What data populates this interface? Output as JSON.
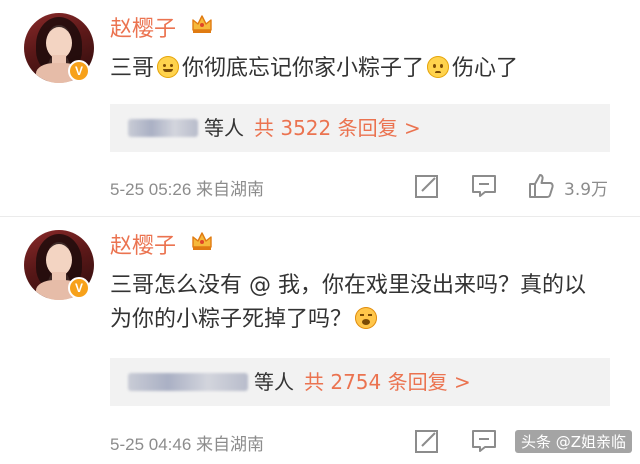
{
  "comments": [
    {
      "username": "赵樱子",
      "text_parts": [
        "三哥",
        "你彻底忘记你家小粽子了",
        "伤心了"
      ],
      "replies_suffix": "等人",
      "replies_link": "共 3522 条回复 >",
      "meta": "5-25 05:26  来自湖南",
      "like_count": "3.9万"
    },
    {
      "username": "赵樱子",
      "text_parts": [
        "三哥怎么没有 @ 我，你在戏里没出来吗？真的以为你的小粽子死掉了吗？"
      ],
      "replies_suffix": "等人",
      "replies_link": "共 2754 条回复 >",
      "meta": "5-25 04:46  来自湖南"
    }
  ],
  "watermark": "头条 @Z姐亲临",
  "colors": {
    "username": "#eb7350",
    "link": "#eb7350",
    "reply_bg": "#f2f2f2",
    "meta": "#8c8c8c",
    "verified": "#f7a11a"
  },
  "icons": [
    "verified-badge-icon",
    "crown-vip-icon",
    "smile-emoji-icon",
    "sad-emoji-icon",
    "cry-emoji-icon",
    "share-icon",
    "comment-icon",
    "like-icon"
  ]
}
